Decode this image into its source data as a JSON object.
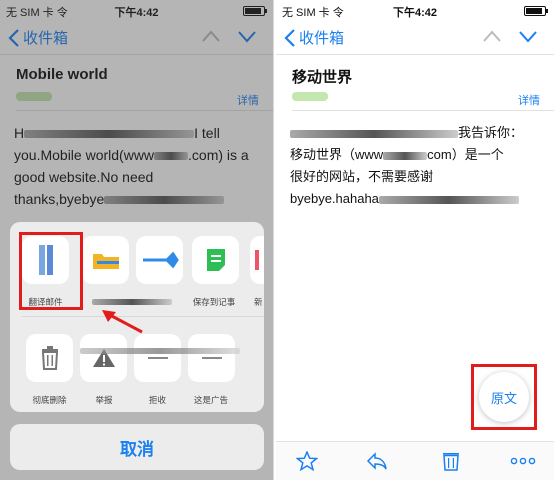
{
  "left": {
    "status": {
      "carrier": "无 SIM 卡 令",
      "time": "下午4:42"
    },
    "nav": {
      "back_label": "收件箱"
    },
    "subject": "Mobile world",
    "details_label": "详情",
    "body": {
      "line1_start": "H",
      "line1_end": "I tell",
      "line2_start": "you.Mobile world(www",
      "line2_end": ".com) is a",
      "line3": "good website.No need",
      "line4": "thanks,byebye"
    },
    "share_row1": [
      {
        "label": "翻译邮件",
        "icon": "document-translate-icon"
      },
      {
        "label": "",
        "icon": "folder-icon"
      },
      {
        "label": "",
        "icon": "blue-tag-icon"
      },
      {
        "label": "保存到记事",
        "icon": "note-icon"
      },
      {
        "label": "新",
        "icon": "partial-icon"
      }
    ],
    "share_row2": [
      {
        "label": "彻底删除",
        "icon": "trash-icon"
      },
      {
        "label": "举报",
        "icon": "warning-icon"
      },
      {
        "label": "拒收",
        "icon": "block-icon"
      },
      {
        "label": "这是广告",
        "icon": "ad-icon"
      }
    ],
    "cancel_label": "取消"
  },
  "right": {
    "status": {
      "carrier": "无 SIM 卡 令",
      "time": "下午4:42"
    },
    "nav": {
      "back_label": "收件箱"
    },
    "subject": "移动世界",
    "details_label": "详情",
    "body": {
      "line1_end": "我告诉你：",
      "line2_start": "移动世界（www",
      "line2_end": "com）是一个",
      "line3": "很好的网站，不需要感谢",
      "line4": "byebye.hahaha"
    },
    "original_label": "原文"
  },
  "colors": {
    "accent": "#1a7ff0",
    "highlight": "#e21b1b",
    "sheet": "#ececec"
  }
}
